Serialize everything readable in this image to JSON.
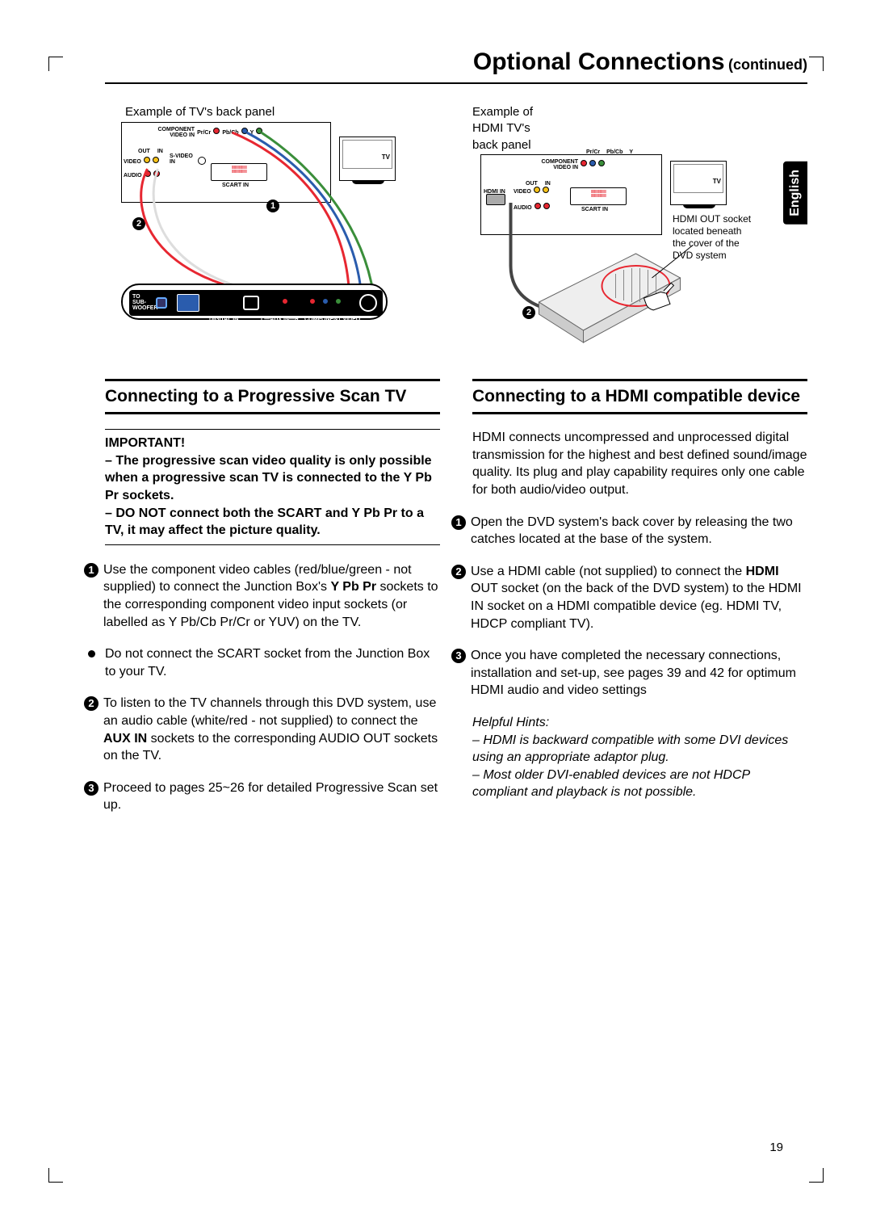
{
  "header": {
    "title": "Optional Connections",
    "continued": "(continued)"
  },
  "lang_tab": "English",
  "left": {
    "diagram_label": "Example of TV's back panel",
    "tv_label": "TV",
    "panel_labels": {
      "component": "COMPONENT VIDEO IN",
      "prcr": "Pr/Cr",
      "pbcb": "Pb/Cb",
      "y": "Y",
      "out": "OUT",
      "in": "IN",
      "video": "VIDEO",
      "svideo": "S-VIDEO IN",
      "audio": "AUDIO",
      "scart": "SCART IN"
    },
    "junction_labels": {
      "sub": "TO SUB-WOOFER",
      "digital": "DIGITAL IN",
      "aux": "L—AUX IN—R",
      "comp": "COMPONENT VIDEO"
    },
    "callout1": "1",
    "callout2": "2",
    "section_title": "Connecting to a Progressive Scan TV",
    "important_heading": "IMPORTANT!",
    "important_p1": "–  The progressive scan video quality is only possible when a progressive scan TV is connected to the Y Pb Pr sockets.",
    "important_p2_a": "–  DO NOT connect both the SCART and Y Pb Pr to a TV, it may affect the picture quality.",
    "step1_a": "Use the component video cables (red/blue/green - not supplied) to connect the Junction Box's ",
    "step1_b": "Y Pb Pr",
    "step1_c": " sockets to the corresponding component video input sockets (or labelled as Y Pb/Cb Pr/Cr or YUV) on the TV.",
    "bullet1": "Do not connect the SCART socket from the Junction Box to your TV.",
    "step2_a": "To listen to the TV channels through this DVD system, use an audio cable (white/red - not supplied) to connect the ",
    "step2_b": "AUX IN",
    "step2_c": " sockets to the corresponding AUDIO OUT sockets on the TV.",
    "step3": "Proceed to pages 25~26 for detailed Progressive Scan set up."
  },
  "right": {
    "diagram_label": "Example of HDMI TV's back panel",
    "tv_label": "TV",
    "panel_labels": {
      "component": "COMPONENT VIDEO IN",
      "prcr": "Pr/Cr",
      "pbcb": "Pb/Cb",
      "y": "Y",
      "out": "OUT",
      "in": "IN",
      "hdmi_in": "HDMI IN",
      "video": "VIDEO",
      "audio": "AUDIO",
      "scart": "SCART IN"
    },
    "hdmi_note": "HDMI OUT socket located beneath the cover of the DVD system",
    "callout2": "2",
    "section_title": "Connecting to a HDMI compatible device",
    "intro": "HDMI connects uncompressed and unprocessed digital transmission for the highest and best defined sound/image quality. Its plug and play capability requires only one cable for both audio/video output.",
    "step1": "Open the DVD system's back cover by releasing the two catches located at the base of the system.",
    "step2_a": "Use a HDMI cable (not supplied) to connect the ",
    "step2_b": "HDMI",
    "step2_c": " OUT socket (on the back of the DVD system) to the HDMI IN socket on a HDMI compatible device (eg. HDMI TV, HDCP compliant TV).",
    "step3": "Once you have completed the necessary connections, installation and set-up, see pages 39 and 42 for optimum HDMI audio and video settings",
    "hints_heading": "Helpful Hints:",
    "hint1": "–  HDMI is backward compatible with some DVI devices using an appropriate adaptor plug.",
    "hint2": "–  Most older DVI-enabled devices are not HDCP compliant and playback is not possible."
  },
  "page_number": "19"
}
